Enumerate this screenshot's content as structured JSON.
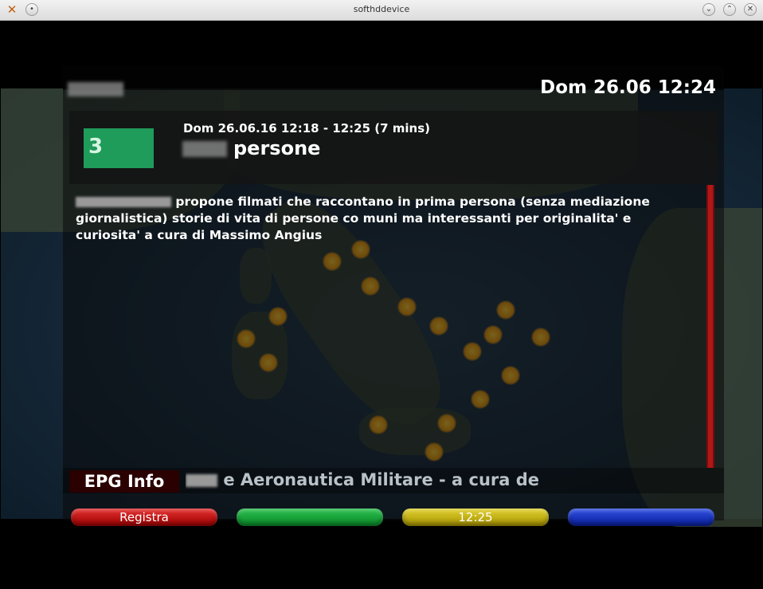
{
  "window": {
    "title": "softhddevice",
    "app_icon": "x-icon",
    "controls": [
      "minimize",
      "maximize",
      "close"
    ]
  },
  "header": {
    "clock": "Dom 26.06 12:24"
  },
  "event": {
    "time": "Dom 26.06.16 12:18 - 12:25 (7 mins)",
    "title": "persone",
    "channel_logo_text": "3"
  },
  "description": {
    "text": "propone filmati che raccontano in prima persona (senza mediazione giornalistica) storie di vita di persone co muni ma interessanti per originalita' e curiosita' a cura di Massimo Angius"
  },
  "footer": {
    "label": "EPG Info",
    "ticker": "e Aeronautica Militare  - a cura de"
  },
  "buttons": {
    "red": "Registra",
    "green": "",
    "yellow": "12:25",
    "blue": ""
  },
  "colors": {
    "red": "#c01818",
    "green": "#1aa63c",
    "yellow": "#c8b418",
    "blue": "#1a36c4",
    "logo_green": "#1f9b5a"
  }
}
